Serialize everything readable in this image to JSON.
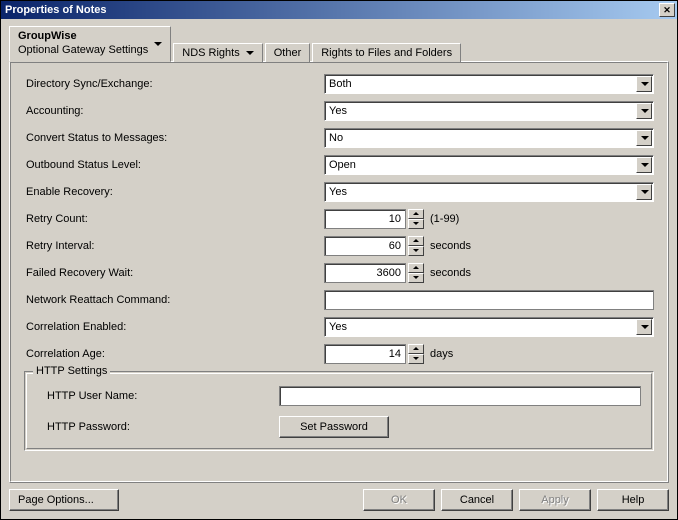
{
  "title": "Properties of Notes",
  "tabs": {
    "groupwise": {
      "label": "GroupWise",
      "sub": "Optional Gateway Settings"
    },
    "nds": "NDS Rights",
    "other": "Other",
    "rights": "Rights to Files and Folders"
  },
  "fields": {
    "dir_sync": {
      "label": "Directory Sync/Exchange:",
      "value": "Both"
    },
    "accounting": {
      "label": "Accounting:",
      "value": "Yes"
    },
    "convert_status": {
      "label": "Convert Status to Messages:",
      "value": "No"
    },
    "outbound_status": {
      "label": "Outbound Status Level:",
      "value": "Open"
    },
    "enable_recovery": {
      "label": "Enable Recovery:",
      "value": "Yes"
    },
    "retry_count": {
      "label": "Retry Count:",
      "value": "10",
      "suffix": "(1-99)"
    },
    "retry_interval": {
      "label": "Retry Interval:",
      "value": "60",
      "suffix": "seconds"
    },
    "failed_recovery": {
      "label": "Failed Recovery Wait:",
      "value": "3600",
      "suffix": "seconds"
    },
    "network_reattach": {
      "label": "Network Reattach Command:",
      "value": ""
    },
    "correlation_enabled": {
      "label": "Correlation Enabled:",
      "value": "Yes"
    },
    "correlation_age": {
      "label": "Correlation Age:",
      "value": "14",
      "suffix": "days"
    }
  },
  "http": {
    "group_title": "HTTP Settings",
    "user_label": "HTTP User Name:",
    "user_value": "",
    "pass_label": "HTTP Password:",
    "set_password": "Set Password"
  },
  "buttons": {
    "page_options": "Page Options...",
    "ok": "OK",
    "cancel": "Cancel",
    "apply": "Apply",
    "help": "Help"
  }
}
